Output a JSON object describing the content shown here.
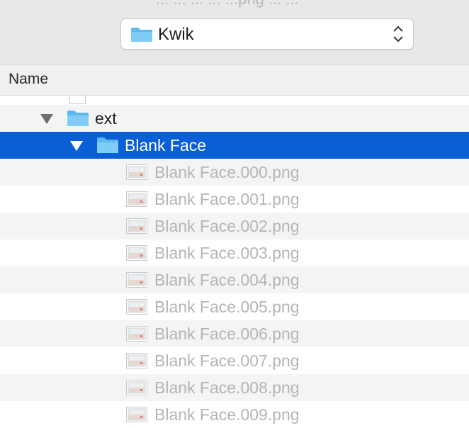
{
  "toolbar": {
    "title_fragment": "... ... ... ... ...png ... ...",
    "location_popup": {
      "label": "Kwik",
      "icon": "folder-icon",
      "chevron": "updown-chevron-icon"
    }
  },
  "list": {
    "column_header": "Name",
    "rows": [
      {
        "name": "ext",
        "kind": "folder",
        "expanded": true,
        "depth": 1
      },
      {
        "name": "Blank Face",
        "kind": "folder",
        "expanded": true,
        "depth": 2,
        "selected": true
      },
      {
        "name": "Blank Face.000.png",
        "kind": "image",
        "depth": 3
      },
      {
        "name": "Blank Face.001.png",
        "kind": "image",
        "depth": 3
      },
      {
        "name": "Blank Face.002.png",
        "kind": "image",
        "depth": 3
      },
      {
        "name": "Blank Face.003.png",
        "kind": "image",
        "depth": 3
      },
      {
        "name": "Blank Face.004.png",
        "kind": "image",
        "depth": 3
      },
      {
        "name": "Blank Face.005.png",
        "kind": "image",
        "depth": 3
      },
      {
        "name": "Blank Face.006.png",
        "kind": "image",
        "depth": 3
      },
      {
        "name": "Blank Face.007.png",
        "kind": "image",
        "depth": 3
      },
      {
        "name": "Blank Face.008.png",
        "kind": "image",
        "depth": 3
      },
      {
        "name": "Blank Face.009.png",
        "kind": "image",
        "depth": 3
      }
    ]
  },
  "colors": {
    "selection": "#0a5fd6",
    "folder": "#6cc3f4",
    "dim_text": "#b5b5b5"
  }
}
